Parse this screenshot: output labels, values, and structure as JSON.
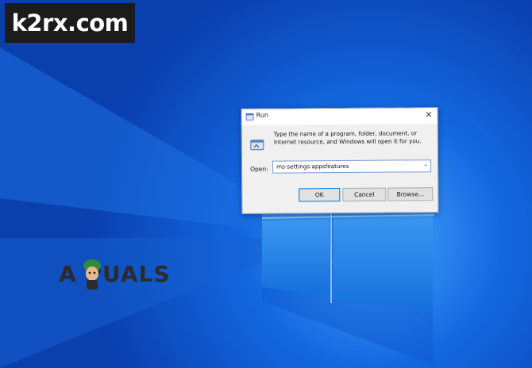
{
  "watermark": {
    "text": "k2rx.com"
  },
  "brand": {
    "text": "A  PUALS"
  },
  "run_dialog": {
    "title": "Run",
    "instruction": "Type the name of a program, folder, document, or Internet resource, and Windows will open it for you.",
    "open_label": "Open:",
    "open_value": "ms-settings:appsfeatures",
    "buttons": {
      "ok": "OK",
      "cancel": "Cancel",
      "browse": "Browse..."
    }
  },
  "colors": {
    "desktop": "#0a4fc8",
    "window_pane": "#2a86e6",
    "dialog_bg": "#f0f0f0",
    "accent": "#0078d7"
  },
  "icons": {
    "title": "run-app-icon",
    "close": "close-icon",
    "dialog": "run-icon",
    "dropdown": "chevron-down-icon"
  }
}
